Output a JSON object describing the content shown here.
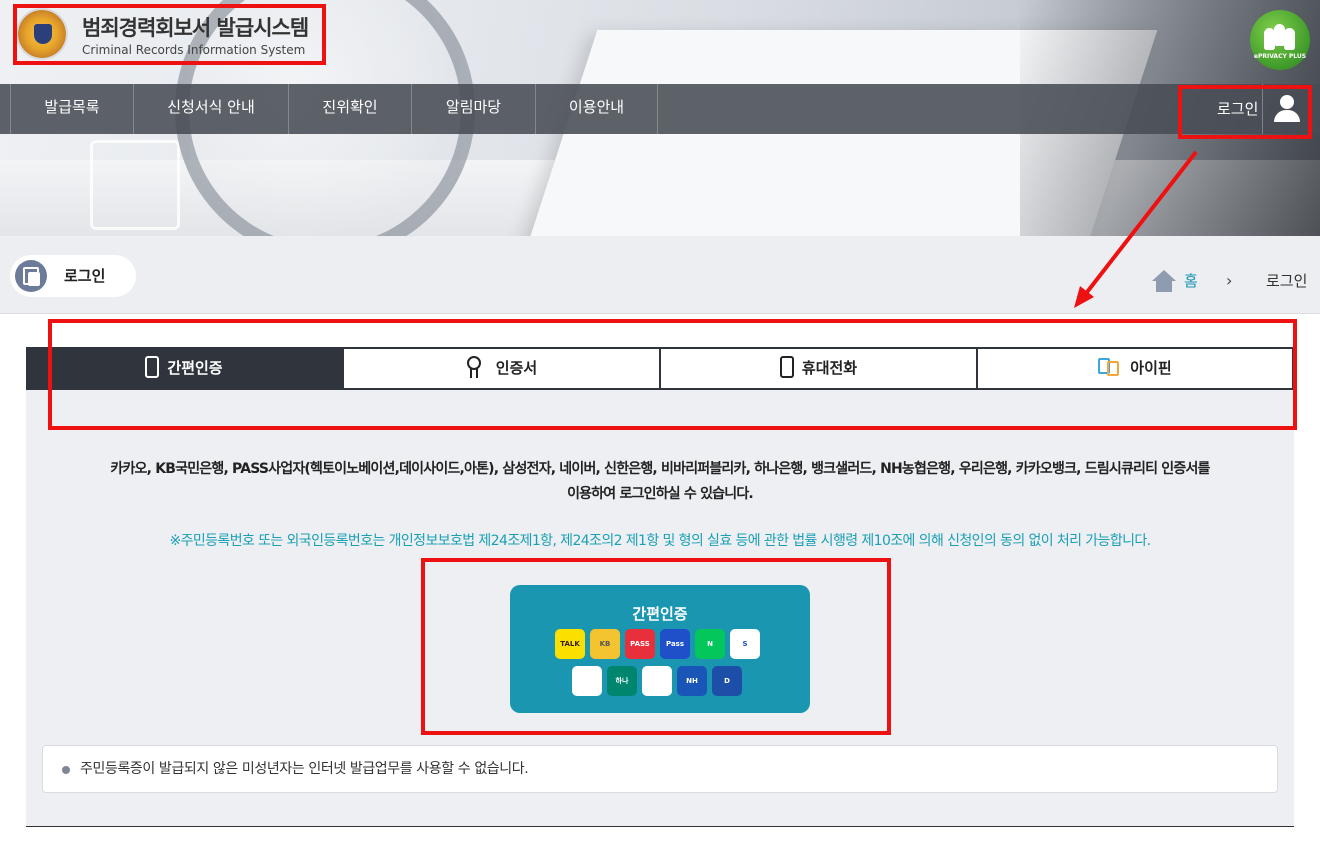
{
  "header": {
    "title": "범죄경력회보서 발급시스템",
    "subtitle": "Criminal Records Information System",
    "eprivacy_text": "ePRIVACY PLUS"
  },
  "nav": {
    "items": [
      {
        "label": "발급목록"
      },
      {
        "label": "신청서식 안내"
      },
      {
        "label": "진위확인"
      },
      {
        "label": "알림마당"
      },
      {
        "label": "이용안내"
      }
    ],
    "login_label": "로그인"
  },
  "page": {
    "title": "로그인",
    "breadcrumb": {
      "home": "홈",
      "separator": "›",
      "current": "로그인"
    }
  },
  "tabs": [
    {
      "label": "간편인증",
      "icon": "phone-icon",
      "active": true
    },
    {
      "label": "인증서",
      "icon": "certificate-icon",
      "active": false
    },
    {
      "label": "휴대전화",
      "icon": "mobile-icon",
      "active": false
    },
    {
      "label": "아이핀",
      "icon": "ipin-icon",
      "active": false
    }
  ],
  "content": {
    "description_line1": "카카오, KB국민은행, PASS사업자(헥토이노베이션,데이사이드,아톤), 삼성전자, 네이버, 신한은행, 비바리퍼블리카, 하나은행, 뱅크샐러드, NH농협은행, 우리은행, 카카오뱅크, 드림시큐리티 인증서를",
    "description_line2": "이용하여 로그인하실 수 있습니다.",
    "notice": "※주민등록번호 또는 외국인등록번호는 개인정보보호법 제24조제1항, 제24조의2 제1항 및 형의 실효 등에 관한 법률 시행령 제10조에 의해 신청인의 동의 없이 처리 가능합니다.",
    "simple_auth_button": {
      "title": "간편인증",
      "apps": [
        {
          "name": "kakao",
          "label": "TALK",
          "bg": "#f9e000",
          "fg": "#3a1d1d"
        },
        {
          "name": "kb",
          "label": "KB",
          "bg": "#f4c430",
          "fg": "#555"
        },
        {
          "name": "pass",
          "label": "PASS",
          "bg": "#e8303c",
          "fg": "#ffffff"
        },
        {
          "name": "samsung-pass",
          "label": "Pass",
          "bg": "#1f4fc9",
          "fg": "#ffffff"
        },
        {
          "name": "naver",
          "label": "N",
          "bg": "#03c75a",
          "fg": "#ffffff"
        },
        {
          "name": "shinhan",
          "label": "S",
          "bg": "#ffffff",
          "fg": "#1b4db8"
        },
        {
          "name": "toss",
          "label": "",
          "bg": "#ffffff",
          "fg": "#1a73e8"
        },
        {
          "name": "hana",
          "label": "하나",
          "bg": "#00856f",
          "fg": "#ffffff"
        },
        {
          "name": "banksalad",
          "label": "",
          "bg": "#ffffff",
          "fg": "#18c2a4"
        },
        {
          "name": "nh",
          "label": "NH",
          "bg": "#1a56b8",
          "fg": "#ffffff"
        },
        {
          "name": "dream",
          "label": "D",
          "bg": "#1d4fa8",
          "fg": "#ffffff"
        }
      ]
    },
    "info": "주민등록증이 발급되지 않은 미성년자는 인터넷 발급업무를 사용할 수 없습니다."
  },
  "colors": {
    "accent": "#2f343d",
    "teal": "#1a96b0",
    "annotation": "#ee1111"
  }
}
